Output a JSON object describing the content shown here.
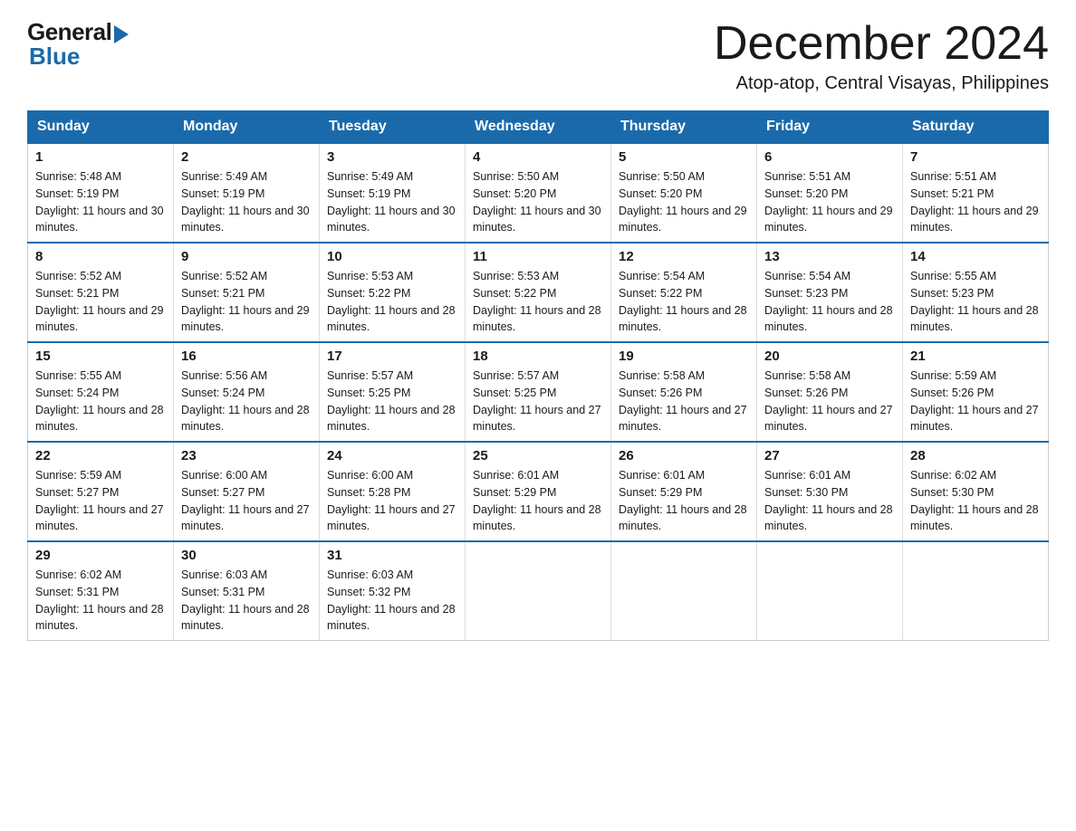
{
  "logo": {
    "general": "General",
    "blue": "Blue"
  },
  "header": {
    "month": "December 2024",
    "location": "Atop-atop, Central Visayas, Philippines"
  },
  "days_of_week": [
    "Sunday",
    "Monday",
    "Tuesday",
    "Wednesday",
    "Thursday",
    "Friday",
    "Saturday"
  ],
  "weeks": [
    [
      {
        "day": "1",
        "sunrise": "Sunrise: 5:48 AM",
        "sunset": "Sunset: 5:19 PM",
        "daylight": "Daylight: 11 hours and 30 minutes."
      },
      {
        "day": "2",
        "sunrise": "Sunrise: 5:49 AM",
        "sunset": "Sunset: 5:19 PM",
        "daylight": "Daylight: 11 hours and 30 minutes."
      },
      {
        "day": "3",
        "sunrise": "Sunrise: 5:49 AM",
        "sunset": "Sunset: 5:19 PM",
        "daylight": "Daylight: 11 hours and 30 minutes."
      },
      {
        "day": "4",
        "sunrise": "Sunrise: 5:50 AM",
        "sunset": "Sunset: 5:20 PM",
        "daylight": "Daylight: 11 hours and 30 minutes."
      },
      {
        "day": "5",
        "sunrise": "Sunrise: 5:50 AM",
        "sunset": "Sunset: 5:20 PM",
        "daylight": "Daylight: 11 hours and 29 minutes."
      },
      {
        "day": "6",
        "sunrise": "Sunrise: 5:51 AM",
        "sunset": "Sunset: 5:20 PM",
        "daylight": "Daylight: 11 hours and 29 minutes."
      },
      {
        "day": "7",
        "sunrise": "Sunrise: 5:51 AM",
        "sunset": "Sunset: 5:21 PM",
        "daylight": "Daylight: 11 hours and 29 minutes."
      }
    ],
    [
      {
        "day": "8",
        "sunrise": "Sunrise: 5:52 AM",
        "sunset": "Sunset: 5:21 PM",
        "daylight": "Daylight: 11 hours and 29 minutes."
      },
      {
        "day": "9",
        "sunrise": "Sunrise: 5:52 AM",
        "sunset": "Sunset: 5:21 PM",
        "daylight": "Daylight: 11 hours and 29 minutes."
      },
      {
        "day": "10",
        "sunrise": "Sunrise: 5:53 AM",
        "sunset": "Sunset: 5:22 PM",
        "daylight": "Daylight: 11 hours and 28 minutes."
      },
      {
        "day": "11",
        "sunrise": "Sunrise: 5:53 AM",
        "sunset": "Sunset: 5:22 PM",
        "daylight": "Daylight: 11 hours and 28 minutes."
      },
      {
        "day": "12",
        "sunrise": "Sunrise: 5:54 AM",
        "sunset": "Sunset: 5:22 PM",
        "daylight": "Daylight: 11 hours and 28 minutes."
      },
      {
        "day": "13",
        "sunrise": "Sunrise: 5:54 AM",
        "sunset": "Sunset: 5:23 PM",
        "daylight": "Daylight: 11 hours and 28 minutes."
      },
      {
        "day": "14",
        "sunrise": "Sunrise: 5:55 AM",
        "sunset": "Sunset: 5:23 PM",
        "daylight": "Daylight: 11 hours and 28 minutes."
      }
    ],
    [
      {
        "day": "15",
        "sunrise": "Sunrise: 5:55 AM",
        "sunset": "Sunset: 5:24 PM",
        "daylight": "Daylight: 11 hours and 28 minutes."
      },
      {
        "day": "16",
        "sunrise": "Sunrise: 5:56 AM",
        "sunset": "Sunset: 5:24 PM",
        "daylight": "Daylight: 11 hours and 28 minutes."
      },
      {
        "day": "17",
        "sunrise": "Sunrise: 5:57 AM",
        "sunset": "Sunset: 5:25 PM",
        "daylight": "Daylight: 11 hours and 28 minutes."
      },
      {
        "day": "18",
        "sunrise": "Sunrise: 5:57 AM",
        "sunset": "Sunset: 5:25 PM",
        "daylight": "Daylight: 11 hours and 27 minutes."
      },
      {
        "day": "19",
        "sunrise": "Sunrise: 5:58 AM",
        "sunset": "Sunset: 5:26 PM",
        "daylight": "Daylight: 11 hours and 27 minutes."
      },
      {
        "day": "20",
        "sunrise": "Sunrise: 5:58 AM",
        "sunset": "Sunset: 5:26 PM",
        "daylight": "Daylight: 11 hours and 27 minutes."
      },
      {
        "day": "21",
        "sunrise": "Sunrise: 5:59 AM",
        "sunset": "Sunset: 5:26 PM",
        "daylight": "Daylight: 11 hours and 27 minutes."
      }
    ],
    [
      {
        "day": "22",
        "sunrise": "Sunrise: 5:59 AM",
        "sunset": "Sunset: 5:27 PM",
        "daylight": "Daylight: 11 hours and 27 minutes."
      },
      {
        "day": "23",
        "sunrise": "Sunrise: 6:00 AM",
        "sunset": "Sunset: 5:27 PM",
        "daylight": "Daylight: 11 hours and 27 minutes."
      },
      {
        "day": "24",
        "sunrise": "Sunrise: 6:00 AM",
        "sunset": "Sunset: 5:28 PM",
        "daylight": "Daylight: 11 hours and 27 minutes."
      },
      {
        "day": "25",
        "sunrise": "Sunrise: 6:01 AM",
        "sunset": "Sunset: 5:29 PM",
        "daylight": "Daylight: 11 hours and 28 minutes."
      },
      {
        "day": "26",
        "sunrise": "Sunrise: 6:01 AM",
        "sunset": "Sunset: 5:29 PM",
        "daylight": "Daylight: 11 hours and 28 minutes."
      },
      {
        "day": "27",
        "sunrise": "Sunrise: 6:01 AM",
        "sunset": "Sunset: 5:30 PM",
        "daylight": "Daylight: 11 hours and 28 minutes."
      },
      {
        "day": "28",
        "sunrise": "Sunrise: 6:02 AM",
        "sunset": "Sunset: 5:30 PM",
        "daylight": "Daylight: 11 hours and 28 minutes."
      }
    ],
    [
      {
        "day": "29",
        "sunrise": "Sunrise: 6:02 AM",
        "sunset": "Sunset: 5:31 PM",
        "daylight": "Daylight: 11 hours and 28 minutes."
      },
      {
        "day": "30",
        "sunrise": "Sunrise: 6:03 AM",
        "sunset": "Sunset: 5:31 PM",
        "daylight": "Daylight: 11 hours and 28 minutes."
      },
      {
        "day": "31",
        "sunrise": "Sunrise: 6:03 AM",
        "sunset": "Sunset: 5:32 PM",
        "daylight": "Daylight: 11 hours and 28 minutes."
      },
      null,
      null,
      null,
      null
    ]
  ]
}
